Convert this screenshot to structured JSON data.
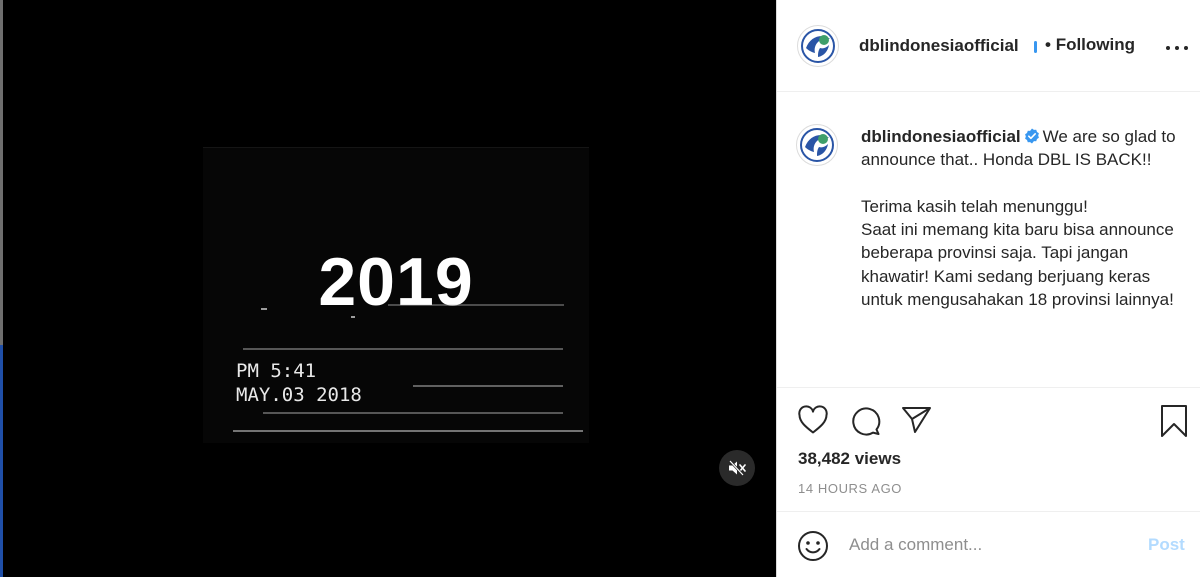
{
  "media": {
    "year_text": "2019",
    "vhs_time": "PM  5:41",
    "vhs_date": "MAY.03 2018",
    "mute_icon": "speaker-muted-icon"
  },
  "header": {
    "username": "dblindonesiaofficial",
    "separator": "•",
    "following_label": "Following",
    "avatar_icon": "dbl-logo-icon",
    "verified_color": "#3897f0"
  },
  "caption": {
    "username": "dblindonesiaofficial",
    "text": "We are so glad to announce that.. Honda DBL IS BACK!!\n\nTerima kasih telah menunggu!\nSaat ini memang kita baru bisa announce beberapa provinsi saja. Tapi jangan khawatir! Kami sedang berjuang keras untuk mengusahakan 18 provinsi lainnya!"
  },
  "actions": {
    "like_icon": "heart-icon",
    "comment_icon": "comment-icon",
    "share_icon": "paper-plane-icon",
    "save_icon": "bookmark-icon"
  },
  "stats": {
    "views": "38,482 views",
    "timestamp": "14 HOURS AGO"
  },
  "comment_box": {
    "placeholder": "Add a comment...",
    "post_label": "Post",
    "emoji_icon": "emoji-icon"
  },
  "colors": {
    "post_disabled": "#b3dbff",
    "verified": "#3897f0",
    "border": "#dbdbdb"
  }
}
